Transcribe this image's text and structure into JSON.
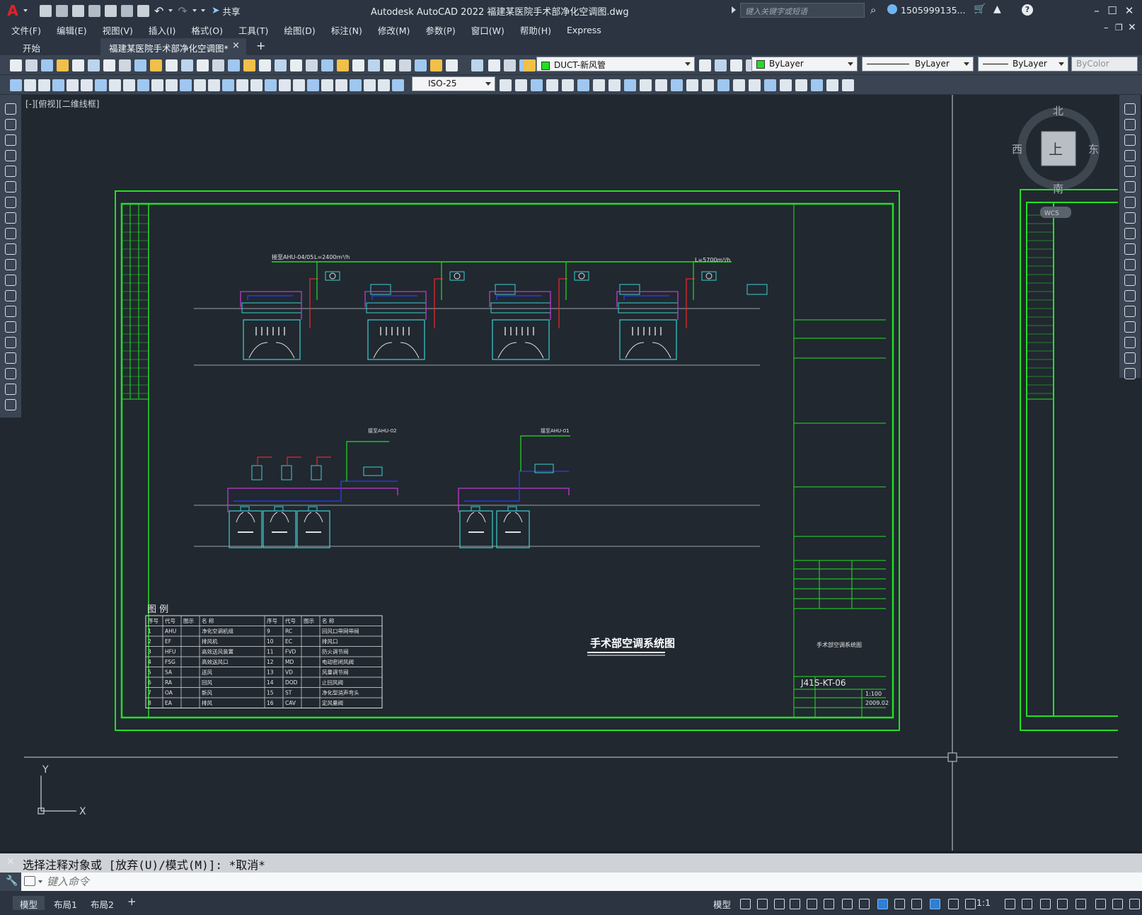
{
  "app": {
    "logo": "A",
    "share_label": "共享",
    "title": "Autodesk AutoCAD 2022    福建某医院手术部净化空调图.dwg",
    "search_placeholder": "键入关键字或短语",
    "user": "1505999135..."
  },
  "menu": [
    "文件(F)",
    "编辑(E)",
    "视图(V)",
    "插入(I)",
    "格式(O)",
    "工具(T)",
    "绘图(D)",
    "标注(N)",
    "修改(M)",
    "参数(P)",
    "窗口(W)",
    "帮助(H)",
    "Express"
  ],
  "tabs": {
    "start": "开始",
    "active_doc": "福建某医院手术部净化空调图*",
    "close": "×",
    "add": "+"
  },
  "toolbar": {
    "layer": "DUCT-新风管",
    "color": "ByLayer",
    "linetype": "ByLayer",
    "lineweight": "ByLayer",
    "plotstyle": "ByColor",
    "dimstyle": "ISO-25",
    "layer_swatch": "#22dd22",
    "color_swatch": "#22dd22"
  },
  "viewport_label": "[-][俯视][二维线框]",
  "viewcube": {
    "north": "北",
    "south": "南",
    "east": "东",
    "west": "西",
    "top": "上",
    "wcs": "WCS"
  },
  "ucs": {
    "x": "X",
    "y": "Y"
  },
  "drawing": {
    "title": "手术部空调系统图",
    "legend_title": "图 例",
    "legend_headers": [
      "序号",
      "代号",
      "图示",
      "名 称",
      "序号",
      "代号",
      "图示",
      "名 称"
    ],
    "legend_rows": [
      [
        "1",
        "AHU",
        "净化空调机组",
        "9",
        "RC",
        "回风口带网带阀"
      ],
      [
        "2",
        "EF",
        "排风机",
        "10",
        "EC",
        "排风口"
      ],
      [
        "3",
        "HFU",
        "高效送风装置",
        "11",
        "FVD",
        "防火调节阀"
      ],
      [
        "4",
        "FSG",
        "高效送风口",
        "12",
        "MD",
        "电动密闭风阀"
      ],
      [
        "5",
        "SA",
        "送风",
        "13",
        "VD",
        "风量调节阀"
      ],
      [
        "6",
        "RA",
        "回风",
        "14",
        "DOD",
        "止回风阀"
      ],
      [
        "7",
        "OA",
        "新风",
        "15",
        "ST",
        "净化型消声弯头"
      ],
      [
        "8",
        "EA",
        "排风",
        "16",
        "CAV",
        "定风量阀"
      ]
    ],
    "drawing_no": "J41S-KT-06",
    "scale": "1:100",
    "date": "2009.02",
    "title_block_name": "手术部空调系统图",
    "duct_label_top": "接至AHU-04/05",
    "duct_flow_top": "L=2400m³/h",
    "duct_flow_right": "L=5700m³/h",
    "duct_label_mid_left": "接至AHU-02",
    "duct_label_mid_right": "接至AHU-01"
  },
  "command": {
    "history": "选择注释对象或 [放弃(U)/模式(M)]: *取消*",
    "placeholder": "键入命令"
  },
  "status": {
    "tabs": [
      "模型",
      "布局1",
      "布局2"
    ],
    "model_label": "模型",
    "scale": "1:1"
  }
}
